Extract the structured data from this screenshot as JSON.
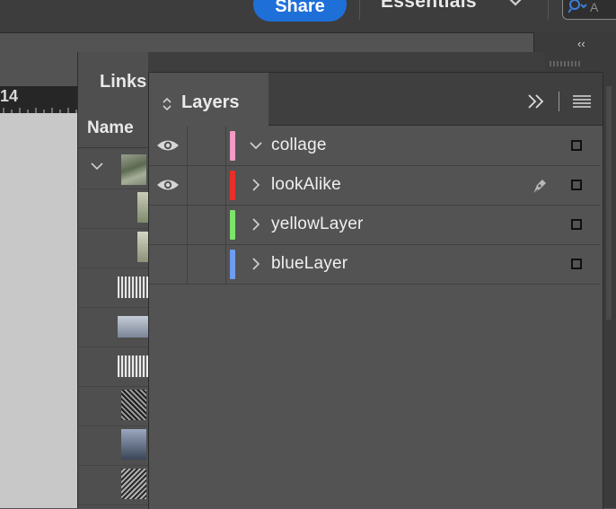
{
  "topbar": {
    "share_label": "Share",
    "workspace_label": "Essentials",
    "search_placeholder": "A"
  },
  "ruler": {
    "number": "14"
  },
  "dock": {
    "collapse_label": "‹‹"
  },
  "links_panel": {
    "tab_label": "Links",
    "column_name": "Name"
  },
  "layers_panel": {
    "tab_label": "Layers",
    "layers": [
      {
        "name": "collage",
        "color": "#f29bc4",
        "visible": true,
        "expanded": true,
        "has_pen": false
      },
      {
        "name": "lookAlike",
        "color": "#e8302a",
        "visible": true,
        "expanded": false,
        "has_pen": true
      },
      {
        "name": "yellowLayer",
        "color": "#7de36a",
        "visible": false,
        "expanded": false,
        "has_pen": false
      },
      {
        "name": "blueLayer",
        "color": "#6d9cf0",
        "visible": false,
        "expanded": false,
        "has_pen": false
      }
    ]
  },
  "colors": {
    "accent": "#1f6fd9",
    "panel": "#535353",
    "chrome": "#3f3f3f"
  },
  "icons": [
    "eye-icon",
    "pen-icon",
    "chevron-right-icon",
    "chevron-down-icon",
    "panel-menu-icon",
    "more-icon",
    "search-icon"
  ]
}
